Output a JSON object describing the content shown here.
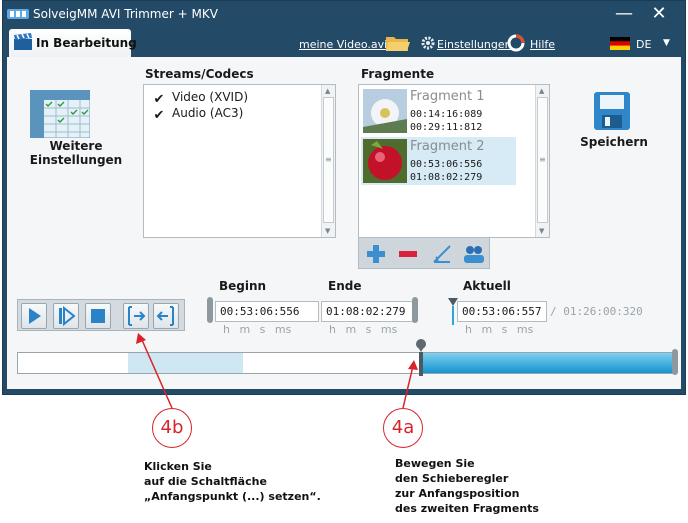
{
  "window": {
    "title": "SolveigMM AVI Trimmer + MKV",
    "minimize_glyph": "—",
    "close_glyph": "✕"
  },
  "menubar": {
    "active_tab": "In Bearbeitung",
    "file_link": "meine Video.avi",
    "settings_link": "Einstellungen",
    "help_link": "Hilfe",
    "language": "DE",
    "lang_arrow": "▼"
  },
  "left_panel": {
    "more_settings_line1": "Weitere",
    "more_settings_line2": "Einstellungen"
  },
  "streams": {
    "label": "Streams/Codecs",
    "items": [
      {
        "label": "Video (XVID)",
        "checked": "✔"
      },
      {
        "label": "Audio (AC3)",
        "checked": "✔"
      }
    ]
  },
  "fragments": {
    "label": "Fragmente",
    "items": [
      {
        "name": "Fragment 1",
        "start": "00:14:16:089",
        "end": "00:29:11:812"
      },
      {
        "name": "Fragment 2",
        "start": "00:53:06:556",
        "end": "01:08:02:279"
      }
    ]
  },
  "save": {
    "label": "Speichern"
  },
  "times": {
    "begin_label": "Beginn",
    "end_label": "Ende",
    "current_label": "Aktuell",
    "begin_value": "00:53:06:556",
    "end_value": "01:08:02:279",
    "current_value": "00:53:06:557",
    "total": "/ 01:26:00:320",
    "units": "h m s ms"
  },
  "annotations": {
    "callout_4b": "4b",
    "callout_4a": "4a",
    "note_4b": [
      "Klicken Sie",
      "auf die Schaltfläche",
      "„Anfangspunkt (...) setzen“."
    ],
    "note_4a": [
      "Bewegen Sie",
      "den Schieberegler",
      "zur Anfangsposition",
      "des zweiten Fragments"
    ]
  },
  "colors": {
    "titlebar": "#234a66",
    "accent_blue": "#1592cf",
    "callout_red": "#d9232a"
  },
  "icons": [
    "app-logo-icon",
    "clapperboard-icon",
    "folder-icon",
    "gear-icon",
    "help-ring-icon",
    "german-flag-icon",
    "settings-grid-icon",
    "floppy-disk-icon",
    "plus-icon",
    "minus-icon",
    "edit-icon",
    "people-icon",
    "play-icon",
    "step-icon",
    "stop-icon",
    "set-start-icon",
    "set-end-icon"
  ]
}
